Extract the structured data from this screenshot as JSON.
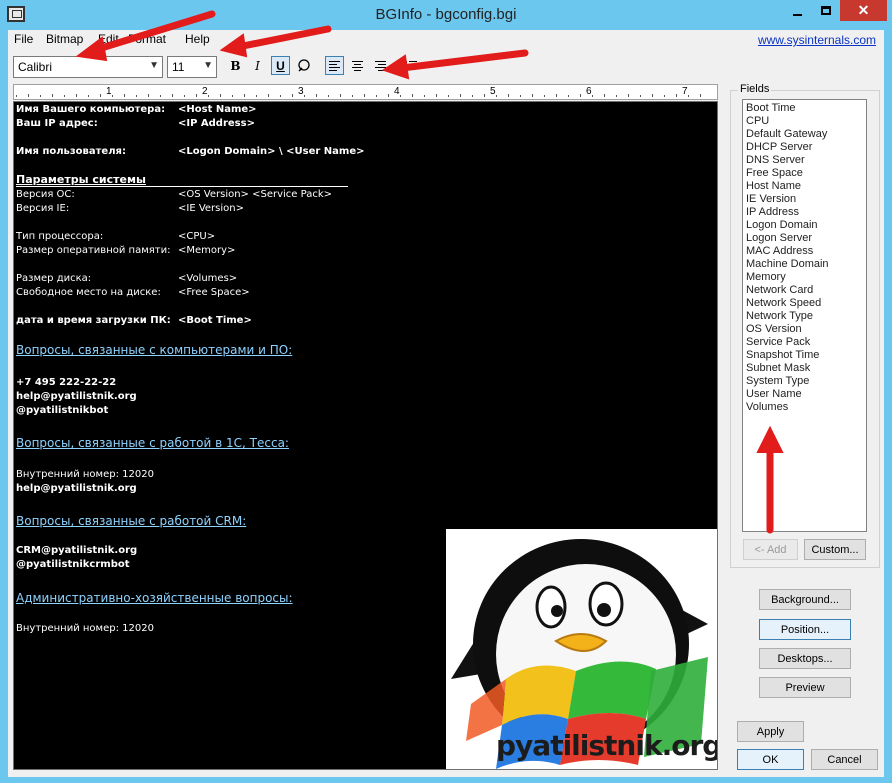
{
  "window": {
    "title": "BGInfo - bgconfig.bgi",
    "close_glyph": "✕"
  },
  "menu": {
    "items": [
      "File",
      "Bitmap",
      "Edit",
      "Format",
      "Help"
    ],
    "link": "www.sysinternals.com"
  },
  "toolbar": {
    "font": "Calibri",
    "size": "11",
    "bold": "B",
    "italic": "I",
    "underline": "U",
    "icons": [
      "bold-icon",
      "italic-icon",
      "underline-icon",
      "insert-image-icon",
      "align-left-icon",
      "align-center-icon",
      "align-right-icon",
      "bullets-icon"
    ]
  },
  "ruler": {
    "numbers": [
      "1",
      "2",
      "3",
      "4",
      "5",
      "6",
      "7"
    ]
  },
  "editor": {
    "lines": [
      {
        "label": "Имя Вашего компьютера:",
        "value": "<Host Name>",
        "bold": true
      },
      {
        "label": "Ваш IP адрес:",
        "value": "<IP Address>",
        "bold": true
      },
      {
        "label": "Имя пользователя:",
        "value": "<Logon Domain> \\ <User Name>",
        "bold": true
      },
      {
        "label": "Версия ОС:",
        "value": "<OS Version> <Service Pack>",
        "bold": false
      },
      {
        "label": "Версия IE:",
        "value": "<IE Version>",
        "bold": false
      },
      {
        "label": "Тип процессора:",
        "value": "<CPU>",
        "bold": false
      },
      {
        "label": "Размер оперативной памяти:",
        "value": "<Memory>",
        "bold": false
      },
      {
        "label": "Размер диска:",
        "value": "<Volumes>",
        "bold": false
      },
      {
        "label": "Свободное место на диске:",
        "value": "<Free Space>",
        "bold": false
      },
      {
        "label": "дата и время загрузки ПК:",
        "value": "<Boot Time>",
        "bold": true
      }
    ],
    "section_title": "Параметры системы",
    "heading1": "Вопросы, связанные с компьютерами и ПО:",
    "contact1": [
      "+7 495 222-22-22",
      "help@pyatilistnik.org",
      "@pyatilistnikbot"
    ],
    "heading2": "Вопросы, связанные с работой в 1С, Тесса:",
    "contact2_plain": "Внутренний номер: 12020",
    "contact2_bold": "help@pyatilistnik.org",
    "heading3": "Вопросы, связанные с работой CRM:",
    "contact3": [
      "CRM@pyatilistnik.org",
      "@pyatilistnikcrmbot"
    ],
    "heading4": "Административно-хозяйственные вопросы:",
    "contact4": "Внутренний номер: 12020"
  },
  "logo": {
    "text": "pyatilistnik.org"
  },
  "fields": {
    "label": "Fields",
    "items": [
      "Boot Time",
      "CPU",
      "Default Gateway",
      "DHCP Server",
      "DNS Server",
      "Free Space",
      "Host Name",
      "IE Version",
      "IP Address",
      "Logon Domain",
      "Logon Server",
      "MAC Address",
      "Machine Domain",
      "Memory",
      "Network Card",
      "Network Speed",
      "Network Type",
      "OS Version",
      "Service Pack",
      "Snapshot Time",
      "Subnet Mask",
      "System Type",
      "User Name",
      "Volumes"
    ],
    "add_label": "<- Add",
    "custom_label": "Custom..."
  },
  "buttons": {
    "background": "Background...",
    "position": "Position...",
    "desktops": "Desktops...",
    "preview": "Preview",
    "apply": "Apply",
    "ok": "OK",
    "cancel": "Cancel"
  },
  "colors": {
    "accent_red": "#e21b1b",
    "titlebar": "#6cc7ee",
    "editor_bg": "#000000",
    "link_blue": "#0b34c4"
  }
}
